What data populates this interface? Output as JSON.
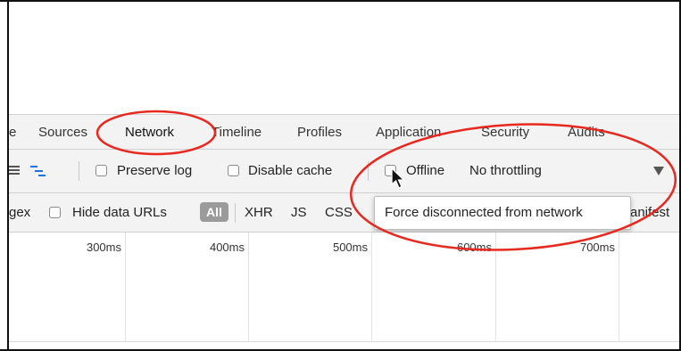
{
  "tabs": [
    {
      "label": "e",
      "name": "tab-console-partial"
    },
    {
      "label": "Sources",
      "name": "tab-sources"
    },
    {
      "label": "Network",
      "name": "tab-network"
    },
    {
      "label": "Timeline",
      "name": "tab-timeline"
    },
    {
      "label": "Profiles",
      "name": "tab-profiles"
    },
    {
      "label": "Application",
      "name": "tab-application"
    },
    {
      "label": "Security",
      "name": "tab-security"
    },
    {
      "label": "Audits",
      "name": "tab-audits"
    }
  ],
  "toolbar": {
    "preserve_log": "Preserve log",
    "disable_cache": "Disable cache",
    "offline": "Offline",
    "throttling": "No throttling",
    "icons": [
      "list-view-icon",
      "waterfall-view-icon",
      "dropdown-arrow-icon",
      "mouse-cursor-icon"
    ]
  },
  "filters": {
    "regex_partial": "gex",
    "hide_data_urls": "Hide data URLs",
    "all": "All",
    "xhr": "XHR",
    "js": "JS",
    "css": "CSS",
    "manifest_partial": "anifest"
  },
  "tooltip": {
    "text": "Force disconnected from network"
  },
  "timeline": {
    "ticks": [
      "300ms",
      "400ms",
      "500ms",
      "600ms",
      "700ms"
    ]
  },
  "colors": {
    "annotation": "#e8281e",
    "toolbar_bg": "#f3f3f3",
    "all_pill": "#9b9b9b"
  }
}
